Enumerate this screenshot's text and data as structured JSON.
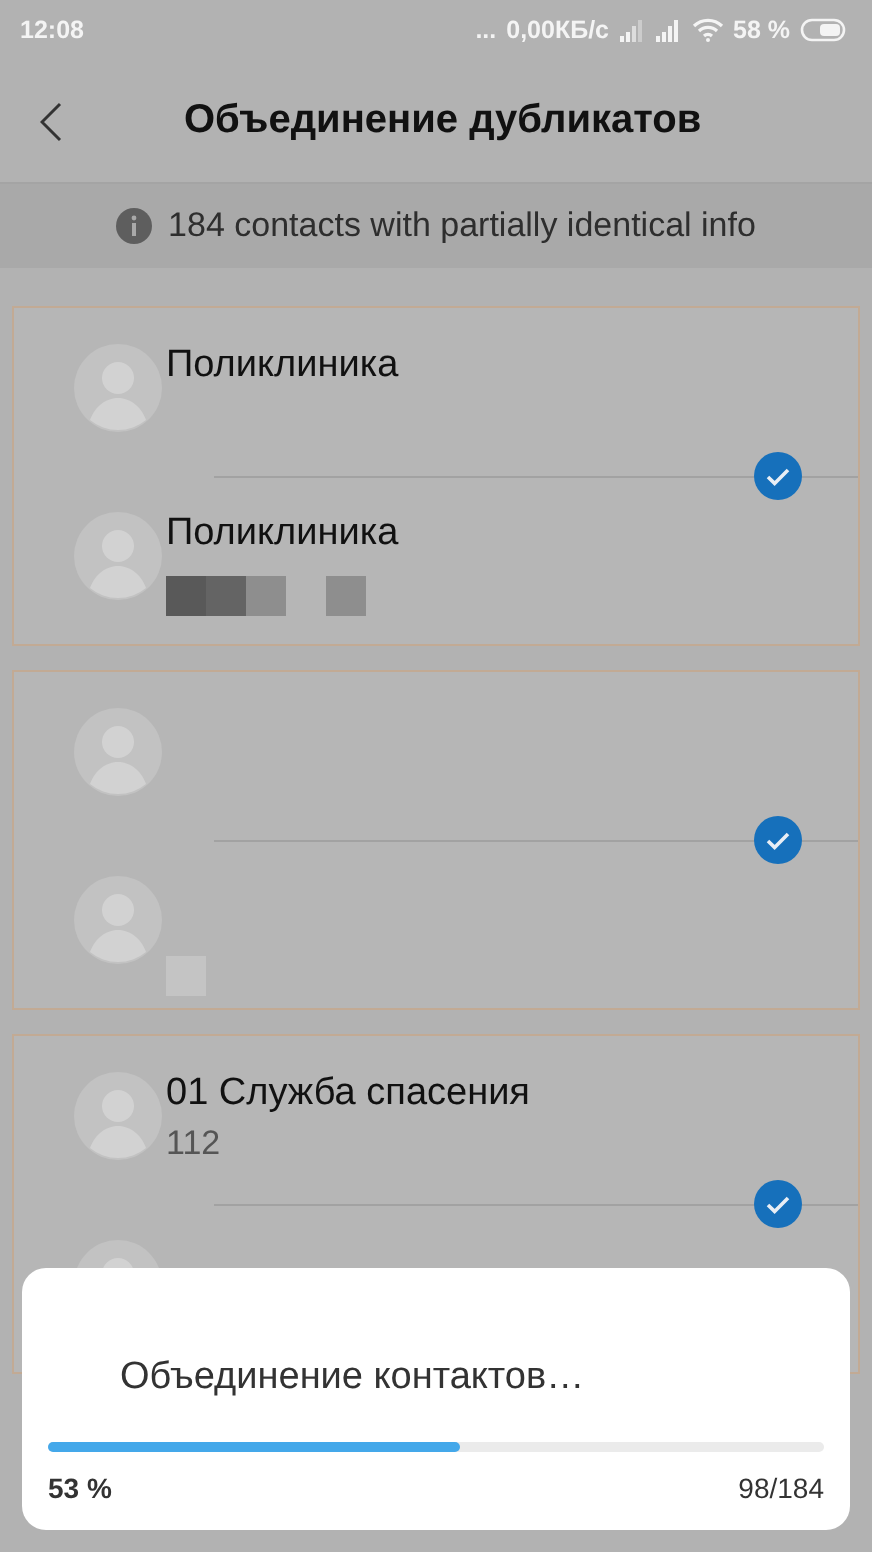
{
  "status_bar": {
    "time": "12:08",
    "dots": "...",
    "net_speed": "0,00КБ/с",
    "battery": "58 %"
  },
  "header": {
    "title": "Объединение дубликатов"
  },
  "info": {
    "text": "184 contacts with partially identical info"
  },
  "groups": [
    {
      "checked": true,
      "contacts": [
        {
          "name": "Поликлиника",
          "masked": false
        },
        {
          "name": "Поликлиника",
          "masked": true
        }
      ]
    },
    {
      "checked": true,
      "contacts": [
        {
          "masked": false
        },
        {
          "masked": true
        }
      ]
    },
    {
      "checked": true,
      "contacts": [
        {
          "name": "01 Служба спасения",
          "phone": "112",
          "masked": false
        },
        {
          "masked": false
        }
      ]
    }
  ],
  "dialog": {
    "message": "Объединение контактов…",
    "level": 0.53,
    "percent": "53 %",
    "count": "98/184"
  }
}
